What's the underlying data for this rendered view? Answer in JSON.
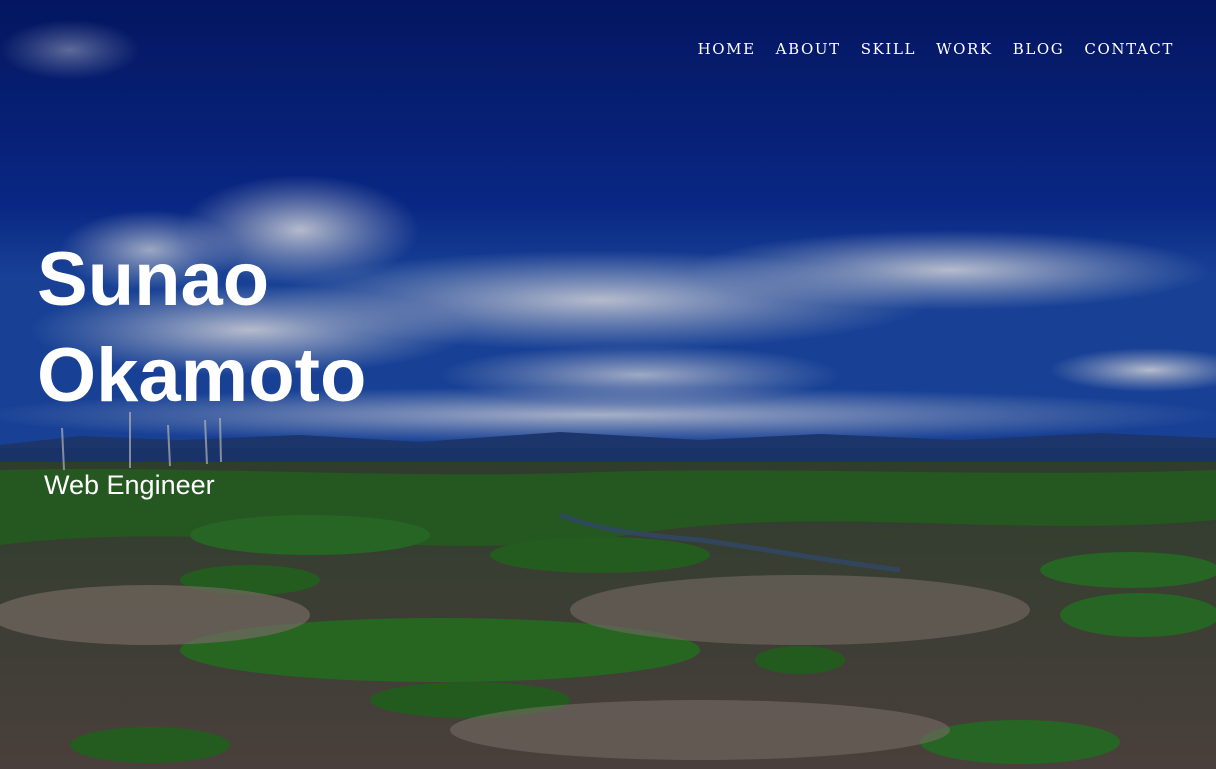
{
  "nav": {
    "items": [
      {
        "label": "HOME"
      },
      {
        "label": "ABOUT"
      },
      {
        "label": "SKILL"
      },
      {
        "label": "WORK"
      },
      {
        "label": "BLOG"
      },
      {
        "label": "CONTACT"
      }
    ]
  },
  "hero": {
    "name_line1": "Sunao",
    "name_line2": "Okamoto",
    "role": "Web Engineer"
  },
  "colors": {
    "sky": "#0c2a8a",
    "text": "#ffffff",
    "grass": "#2f6b22",
    "ground": "#8a7a6a"
  }
}
